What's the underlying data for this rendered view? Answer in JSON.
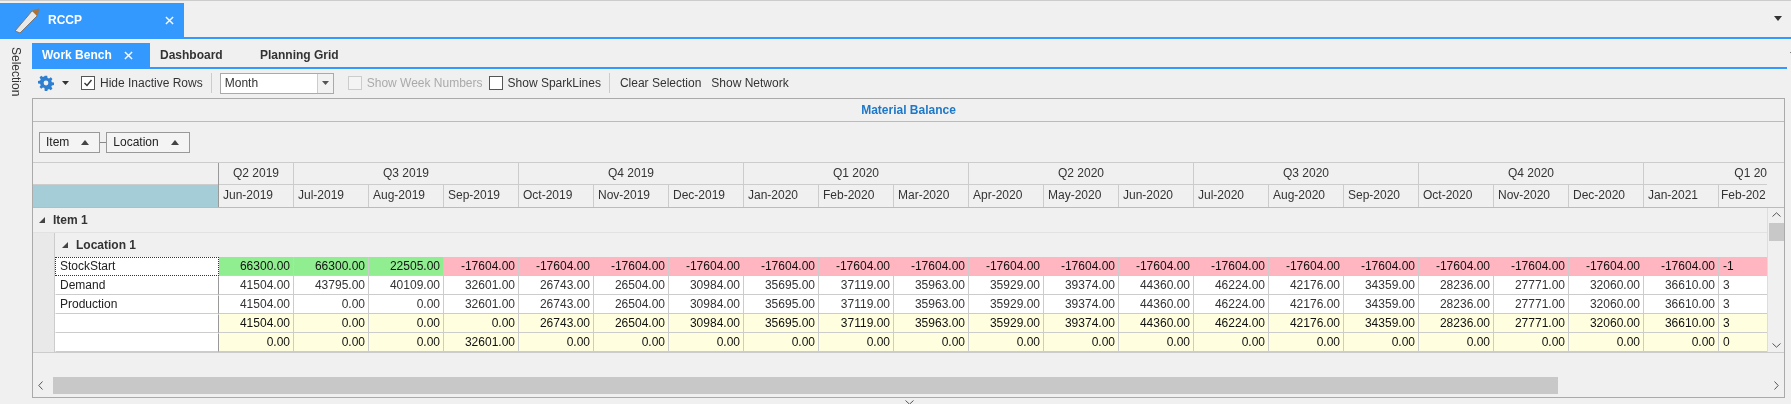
{
  "document_tabs": [
    {
      "label": "RCCP",
      "selected": true
    }
  ],
  "side_panel": {
    "label": "Selection"
  },
  "tabs": [
    {
      "label": "Work Bench",
      "selected": true
    },
    {
      "label": "Dashboard",
      "selected": false
    },
    {
      "label": "Planning Grid",
      "selected": false
    }
  ],
  "toolbar": {
    "hide_inactive_rows": {
      "label": "Hide Inactive Rows",
      "checked": true,
      "disabled": false
    },
    "period": {
      "value": "Month"
    },
    "show_week_numbers": {
      "label": "Show Week Numbers",
      "checked": false,
      "disabled": true
    },
    "show_sparklines": {
      "label": "Show SparkLines",
      "checked": false,
      "disabled": false
    },
    "buttons": [
      "Clear Selection",
      "Show Network"
    ]
  },
  "grid": {
    "title": "Material Balance",
    "group_fields": [
      {
        "label": "Item"
      },
      {
        "label": "Location"
      }
    ],
    "quarters": [
      {
        "label": "Q2 2019",
        "months": [
          "Jun-2019"
        ]
      },
      {
        "label": "Q3 2019",
        "months": [
          "Jul-2019",
          "Aug-2019",
          "Sep-2019"
        ]
      },
      {
        "label": "Q4 2019",
        "months": [
          "Oct-2019",
          "Nov-2019",
          "Dec-2019"
        ]
      },
      {
        "label": "Q1 2020",
        "months": [
          "Jan-2020",
          "Feb-2020",
          "Mar-2020"
        ]
      },
      {
        "label": "Q2 2020",
        "months": [
          "Apr-2020",
          "May-2020",
          "Jun-2020"
        ]
      },
      {
        "label": "Q3 2020",
        "months": [
          "Jul-2020",
          "Aug-2020",
          "Sep-2020"
        ]
      },
      {
        "label": "Q4 2020",
        "months": [
          "Oct-2020",
          "Nov-2020",
          "Dec-2020"
        ]
      },
      {
        "label": "Q1 20",
        "months": [
          "Jan-2021",
          "Feb-202"
        ]
      }
    ],
    "groups": [
      {
        "label": "Item 1",
        "expanded": true,
        "children": [
          {
            "label": "Location 1",
            "expanded": true,
            "rows": [
              {
                "label": "StockStart",
                "kind": "balance",
                "selected": true,
                "cells": [
                  {
                    "value": "66300.00",
                    "color": "#90ee90"
                  },
                  {
                    "value": "66300.00",
                    "color": "#90ee90"
                  },
                  {
                    "value": "22505.00",
                    "color": "#90ee90"
                  },
                  {
                    "value": "-17604.00",
                    "color": "#ffb6c1"
                  },
                  {
                    "value": "-17604.00",
                    "color": "#ffb6c1"
                  },
                  {
                    "value": "-17604.00",
                    "color": "#ffb6c1"
                  },
                  {
                    "value": "-17604.00",
                    "color": "#ffb6c1"
                  },
                  {
                    "value": "-17604.00",
                    "color": "#ffb6c1"
                  },
                  {
                    "value": "-17604.00",
                    "color": "#ffb6c1"
                  },
                  {
                    "value": "-17604.00",
                    "color": "#ffb6c1"
                  },
                  {
                    "value": "-17604.00",
                    "color": "#ffb6c1"
                  },
                  {
                    "value": "-17604.00",
                    "color": "#ffb6c1"
                  },
                  {
                    "value": "-17604.00",
                    "color": "#ffb6c1"
                  },
                  {
                    "value": "-17604.00",
                    "color": "#ffb6c1"
                  },
                  {
                    "value": "-17604.00",
                    "color": "#ffb6c1"
                  },
                  {
                    "value": "-17604.00",
                    "color": "#ffb6c1"
                  },
                  {
                    "value": "-17604.00",
                    "color": "#ffb6c1"
                  },
                  {
                    "value": "-17604.00",
                    "color": "#ffb6c1"
                  },
                  {
                    "value": "-17604.00",
                    "color": "#ffb6c1"
                  },
                  {
                    "value": "-17604.00",
                    "color": "#ffb6c1"
                  },
                  {
                    "value": "-1",
                    "color": "#ffb6c1"
                  }
                ]
              },
              {
                "label": "Demand",
                "kind": "plain",
                "selected": false,
                "cells": [
                  "41504.00",
                  "43795.00",
                  "40109.00",
                  "32601.00",
                  "26743.00",
                  "26504.00",
                  "30984.00",
                  "35695.00",
                  "37119.00",
                  "35963.00",
                  "35929.00",
                  "39374.00",
                  "44360.00",
                  "46224.00",
                  "42176.00",
                  "34359.00",
                  "28236.00",
                  "27771.00",
                  "32060.00",
                  "36610.00",
                  "3"
                ]
              },
              {
                "label": "Production",
                "kind": "plain",
                "selected": false,
                "cells": [
                  "41504.00",
                  "0.00",
                  "0.00",
                  "32601.00",
                  "26743.00",
                  "26504.00",
                  "30984.00",
                  "35695.00",
                  "37119.00",
                  "35963.00",
                  "35929.00",
                  "39374.00",
                  "44360.00",
                  "46224.00",
                  "42176.00",
                  "34359.00",
                  "28236.00",
                  "27771.00",
                  "32060.00",
                  "36610.00",
                  "3"
                ]
              },
              {
                "kind": "total",
                "selected": false,
                "cells": [
                  "41504.00",
                  "0.00",
                  "0.00",
                  "0.00",
                  "26743.00",
                  "26504.00",
                  "30984.00",
                  "35695.00",
                  "37119.00",
                  "35963.00",
                  "35929.00",
                  "39374.00",
                  "44360.00",
                  "46224.00",
                  "42176.00",
                  "34359.00",
                  "28236.00",
                  "27771.00",
                  "32060.00",
                  "36610.00",
                  "3"
                ]
              },
              {
                "kind": "total",
                "selected": false,
                "cells": [
                  "0.00",
                  "0.00",
                  "0.00",
                  "32601.00",
                  "0.00",
                  "0.00",
                  "0.00",
                  "0.00",
                  "0.00",
                  "0.00",
                  "0.00",
                  "0.00",
                  "0.00",
                  "0.00",
                  "0.00",
                  "0.00",
                  "0.00",
                  "0.00",
                  "0.00",
                  "0.00",
                  "0"
                ]
              }
            ]
          }
        ]
      }
    ]
  }
}
